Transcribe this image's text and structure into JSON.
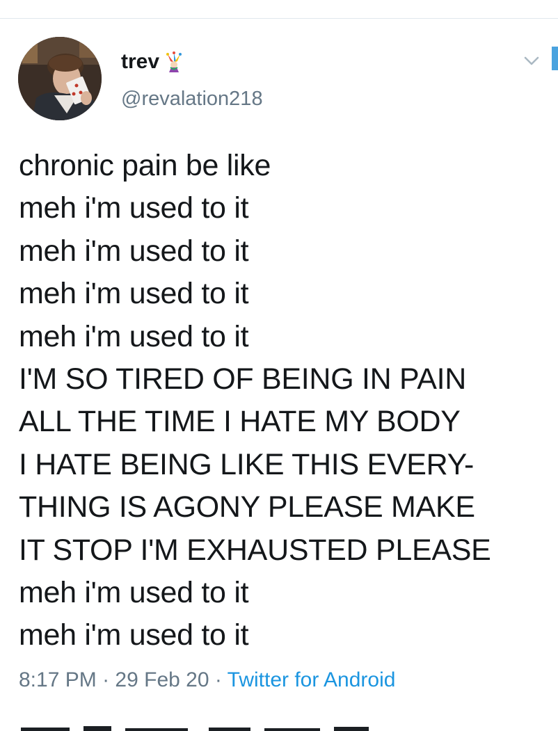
{
  "tweet": {
    "author": {
      "display_name": "trev",
      "name_emoji": "jester-emoji",
      "handle": "@revalation218",
      "avatar_icon": "profile-avatar"
    },
    "menu_icon": "chevron-down-icon",
    "lines": [
      "chronic pain be like",
      "meh i'm used to it",
      "meh i'm used to it",
      "meh i'm used to it",
      "meh i'm used to it",
      "I'M SO TIRED OF BEING IN PAIN",
      "ALL THE TIME I HATE MY BODY",
      "I HATE BEING LIKE THIS EVERY-",
      "THING IS AGONY PLEASE MAKE",
      "IT STOP I'M EXHAUSTED PLEASE",
      "meh i'm used to it",
      "meh i'm used to it"
    ],
    "meta": {
      "time": "8:17 PM",
      "separator": "·",
      "date": "29 Feb 20",
      "source": "Twitter for Android"
    }
  },
  "colors": {
    "text": "#14171a",
    "secondary": "#657786",
    "link": "#1b95e0",
    "divider": "#e1e8ed"
  }
}
